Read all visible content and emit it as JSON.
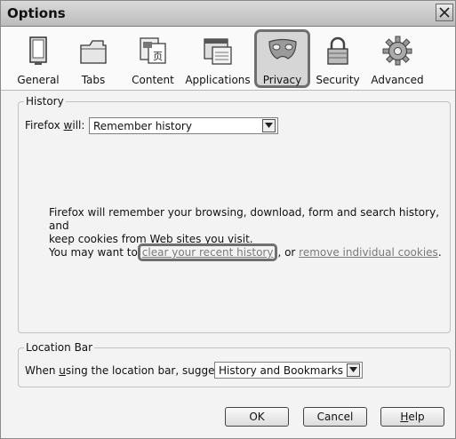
{
  "window": {
    "title": "Options"
  },
  "toolbar": {
    "tabs": [
      {
        "label": "General",
        "icon": "general-icon"
      },
      {
        "label": "Tabs",
        "icon": "tabs-icon"
      },
      {
        "label": "Content",
        "icon": "content-icon"
      },
      {
        "label": "Applications",
        "icon": "applications-icon"
      },
      {
        "label": "Privacy",
        "icon": "privacy-mask-icon",
        "selected": true
      },
      {
        "label": "Security",
        "icon": "lock-icon"
      },
      {
        "label": "Advanced",
        "icon": "gear-icon"
      }
    ]
  },
  "history": {
    "legend": "History",
    "firefox_will_label_pre": "Firefox ",
    "firefox_will_label_u": "w",
    "firefox_will_label_post": "ill:",
    "mode_value": "Remember history",
    "description_line1": "Firefox will remember your browsing, download, form and search history, and",
    "description_line2": "keep cookies from Web sites you visit.",
    "clear_prefix": "You may want to",
    "clear_link": "clear your recent history",
    "clear_mid": ", or ",
    "remove_link": "remove individual cookies",
    "clear_suffix": "."
  },
  "location_bar": {
    "legend": "Location Bar",
    "suggest_label_pre": "When ",
    "suggest_label_u": "u",
    "suggest_label_post": "sing the location bar, suggest:",
    "suggest_value": "History and Bookmarks"
  },
  "buttons": {
    "ok": "OK",
    "cancel": "Cancel",
    "help_u": "H",
    "help_rest": "elp"
  }
}
